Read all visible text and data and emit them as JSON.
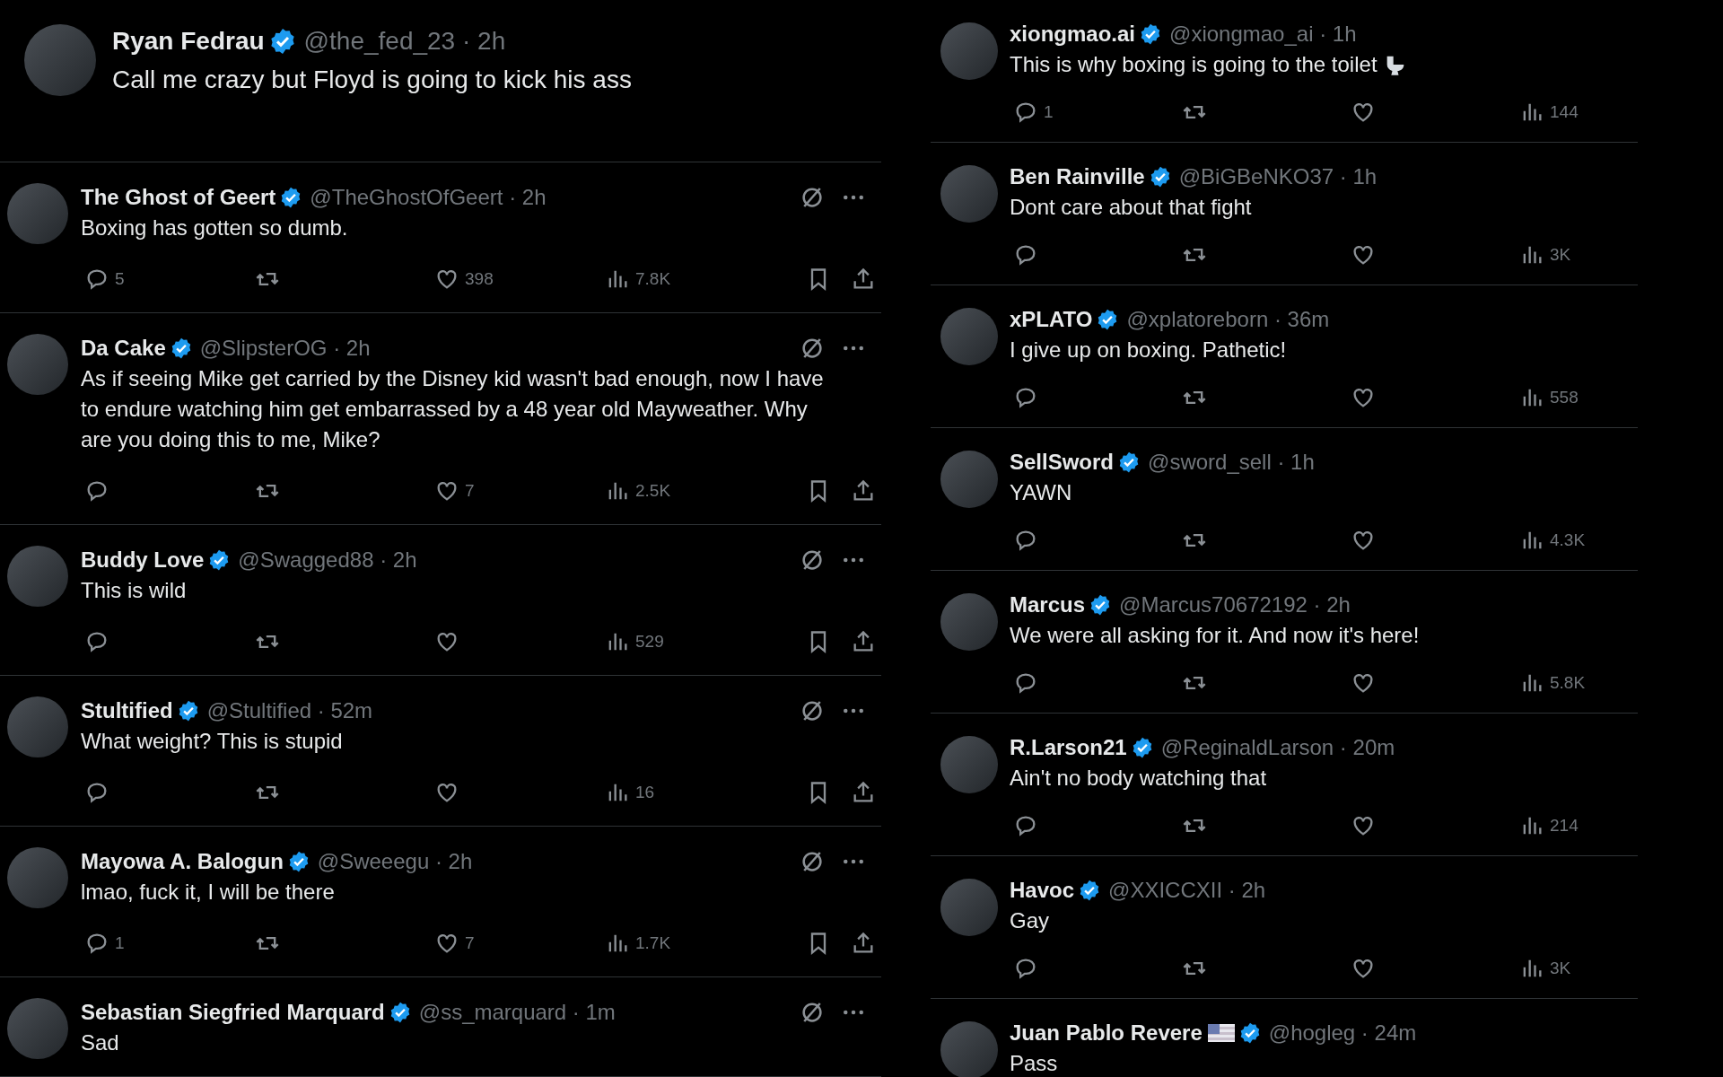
{
  "left_panel": {
    "main_post": {
      "author": "Ryan Fedrau",
      "byline": "@the_fed_23 · 2h",
      "text": "Call me crazy but Floyd is going to kick his ass"
    },
    "replies": [
      {
        "author": "The Ghost of Geert",
        "byline": "@TheGhostOfGeert · 2h",
        "text": "Boxing has gotten so dumb.",
        "reply_count": "5",
        "likes": "398",
        "views": "7.8K"
      },
      {
        "author": "Da Cake",
        "byline": "@SlipsterOG · 2h",
        "text": "As if seeing Mike get carried by the Disney kid wasn't bad enough, now I have to endure watching him get embarrassed by a 48 year old Mayweather. Why are you doing this to me, Mike?",
        "likes": "7",
        "views": "2.5K"
      },
      {
        "author": "Buddy Love",
        "byline": "@Swagged88 · 2h",
        "text": "This is wild",
        "views": "529"
      },
      {
        "author": "Stultified",
        "byline": "@Stultified · 52m",
        "text": "What weight? This is stupid",
        "views": "16"
      },
      {
        "author": "Mayowa A. Balogun",
        "byline": "@Sweeegu · 2h",
        "text": "lmao, fuck it, I will be there",
        "reply_count": "1",
        "likes": "7",
        "views": "1.7K"
      },
      {
        "author": "Sebastian Siegfried Marquard",
        "byline": "@ss_marquard · 1m",
        "text": "Sad"
      }
    ]
  },
  "right_panel": {
    "replies": [
      {
        "author": "xiongmao.ai",
        "flag": false,
        "byline": "@xiongmao_ai · 1h",
        "text": "This is why boxing is going to the toilet",
        "toilet": true,
        "reply_count": "1",
        "views": "144"
      },
      {
        "author": "Ben Rainville",
        "flag": false,
        "byline": "@BiGBeNKO37 · 1h",
        "text": "Dont care about that fight",
        "toilet": false,
        "views": "3K"
      },
      {
        "author": "xPLATO",
        "flag": false,
        "byline": "@xplatoreborn · 36m",
        "text": "I give up on boxing. Pathetic!",
        "toilet": false,
        "views": "558"
      },
      {
        "author": "SellSword",
        "flag": false,
        "byline": "@sword_sell · 1h",
        "text": "YAWN",
        "toilet": false,
        "views": "4.3K"
      },
      {
        "author": "Marcus",
        "flag": false,
        "byline": "@Marcus70672192 · 2h",
        "text": "We were all asking for it. And now it's here!",
        "toilet": false,
        "views": "5.8K"
      },
      {
        "author": "R.Larson21",
        "flag": false,
        "byline": "@ReginaldLarson · 20m",
        "text": "Ain't no body watching that",
        "toilet": false,
        "views": "214"
      },
      {
        "author": "Havoc",
        "flag": false,
        "byline": "@XXICCXII · 2h",
        "text": "Gay",
        "toilet": false,
        "views": "3K"
      },
      {
        "author": "Juan Pablo Revere",
        "flag": true,
        "byline": "@hogleg · 24m",
        "text": "Pass",
        "toilet": false
      }
    ]
  }
}
